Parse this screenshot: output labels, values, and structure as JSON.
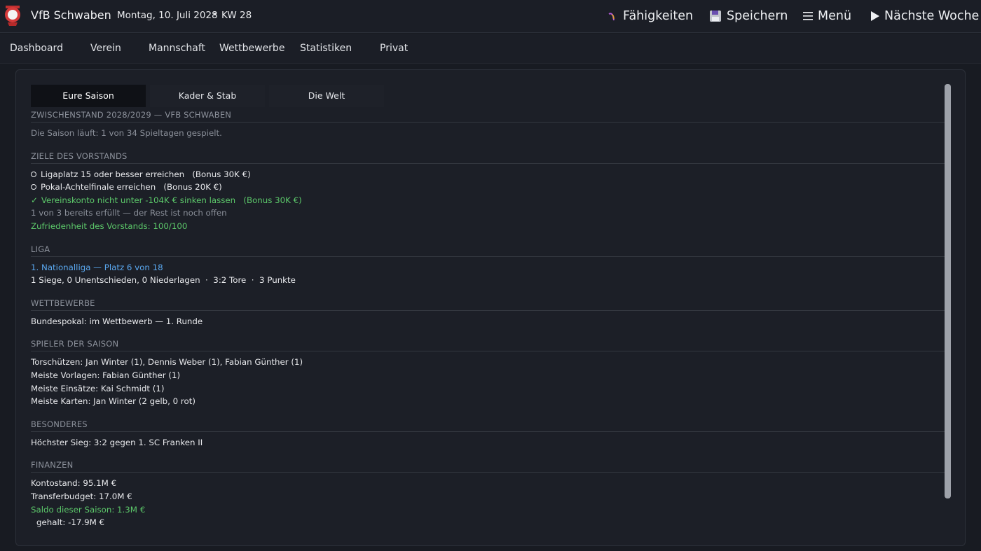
{
  "header": {
    "club_name": "VfB Schwaben",
    "date": "Montag, 10. Juli 2028",
    "separator": "•",
    "week": "KW 28",
    "buttons": {
      "skills": "Fähigkeiten",
      "save": "Speichern",
      "menu": "Menü",
      "next_week": "Nächste Woche"
    }
  },
  "nav": [
    "Dashboard",
    "Verein",
    "Mannschaft",
    "Wettbewerbe",
    "Statistiken",
    "Privat"
  ],
  "tabs": [
    "Eure Saison",
    "Kader & Stab",
    "Die Welt"
  ],
  "sections": {
    "standing": {
      "title": "ZWISCHENSTAND 2028/2029 — VFB SCHWABEN",
      "text": "Die Saison läuft: 1 von 34 Spieltagen gespielt."
    },
    "board": {
      "title": "ZIELE DES VORSTANDS",
      "goals": [
        {
          "text": "Ligaplatz 15 oder besser erreichen",
          "bonus": "(Bonus 30K €)",
          "done": false
        },
        {
          "text": "Pokal-Achtelfinale erreichen",
          "bonus": "(Bonus 20K €)",
          "done": false
        },
        {
          "text": "Vereinskonto nicht unter -104K € sinken lassen",
          "bonus": "(Bonus 30K €)",
          "done": true
        }
      ],
      "summary": "1 von 3 bereits erfüllt — der Rest ist noch offen",
      "satisfaction": "Zufriedenheit des Vorstands: 100/100"
    },
    "league": {
      "title": "LIGA",
      "position": "1. Nationalliga — Platz 6 von 18",
      "record": "1 Siege, 0 Unentschieden, 0 Niederlagen  ·  3:2 Tore  ·  3 Punkte"
    },
    "competitions": {
      "title": "WETTBEWERBE",
      "text": "Bundespokal: im Wettbewerb — 1. Runde"
    },
    "players": {
      "title": "SPIELER DER SAISON",
      "lines": [
        "Torschützen: Jan Winter (1), Dennis Weber (1), Fabian Günther (1)",
        "Meiste Vorlagen: Fabian Günther (1)",
        "Meiste Einsätze: Kai Schmidt (1)",
        "Meiste Karten: Jan Winter (2 gelb, 0 rot)"
      ]
    },
    "special": {
      "title": "BESONDERES",
      "text": "Höchster Sieg: 3:2 gegen 1. SC Franken II"
    },
    "finances": {
      "title": "FINANZEN",
      "balance": "Kontostand: 95.1M €",
      "transfer": "Transferbudget: 17.0M €",
      "saldo": "Saldo dieser Saison: 1.3M €",
      "salary": "gehalt: -17.9M €"
    }
  },
  "colors": {
    "background": "#181b22",
    "panel": "#1c1f27",
    "green": "#5cc86a",
    "blue": "#5aa8f0",
    "logo_red": "#d63a3a"
  },
  "icons": {
    "skills": "magic-wand-icon",
    "save": "floppy-disk-icon",
    "menu": "hamburger-icon",
    "next": "play-icon"
  }
}
